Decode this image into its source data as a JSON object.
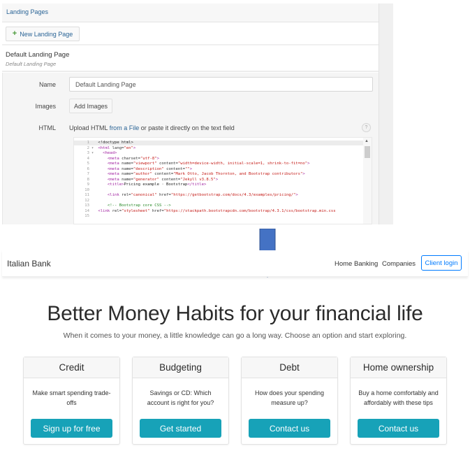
{
  "admin": {
    "section_title": "Landing Pages",
    "new_button_label": "New Landing Page",
    "new_button_icon": "plus-icon",
    "item": {
      "title": "Default Landing Page",
      "subtitle": "Default Landing Page"
    },
    "form": {
      "name_label": "Name",
      "name_value": "Default Landing Page",
      "images_label": "Images",
      "images_button": "Add Images",
      "html_label": "HTML",
      "upload_prefix": "Upload HTML ",
      "upload_link": "from a File",
      "upload_suffix": " or paste it directly on the text field",
      "help_icon": "?"
    },
    "code_lines": [
      {
        "n": "1",
        "fold": "",
        "parts": [
          [
            "tx",
            "<!doctype html>"
          ]
        ]
      },
      {
        "n": "2",
        "fold": "▾",
        "parts": [
          [
            "tg",
            "<html "
          ],
          [
            "at",
            "lang="
          ],
          [
            "st",
            "\"en\""
          ],
          [
            "tg",
            ">"
          ]
        ]
      },
      {
        "n": "3",
        "fold": "▾",
        "parts": [
          [
            "tx",
            "  "
          ],
          [
            "tg",
            "<head>"
          ]
        ]
      },
      {
        "n": "4",
        "fold": "",
        "parts": [
          [
            "tx",
            "    "
          ],
          [
            "tg",
            "<meta "
          ],
          [
            "at",
            "charset="
          ],
          [
            "st",
            "\"utf-8\""
          ],
          [
            "tg",
            ">"
          ]
        ]
      },
      {
        "n": "5",
        "fold": "",
        "parts": [
          [
            "tx",
            "    "
          ],
          [
            "tg",
            "<meta "
          ],
          [
            "at",
            "name="
          ],
          [
            "st",
            "\"viewport\""
          ],
          [
            "at",
            " content="
          ],
          [
            "st",
            "\"width=device-width, initial-scale=1, shrink-to-fit=no\""
          ],
          [
            "tg",
            ">"
          ]
        ]
      },
      {
        "n": "6",
        "fold": "",
        "parts": [
          [
            "tx",
            "    "
          ],
          [
            "tg",
            "<meta "
          ],
          [
            "at",
            "name="
          ],
          [
            "st",
            "\"description\""
          ],
          [
            "at",
            " content="
          ],
          [
            "st",
            "\"\""
          ],
          [
            "tg",
            ">"
          ]
        ]
      },
      {
        "n": "7",
        "fold": "",
        "parts": [
          [
            "tx",
            "    "
          ],
          [
            "tg",
            "<meta "
          ],
          [
            "at",
            "name="
          ],
          [
            "st",
            "\"author\""
          ],
          [
            "at",
            " content="
          ],
          [
            "st",
            "\"Mark Otto, Jacob Thornton, and Bootstrap contributors\""
          ],
          [
            "tg",
            ">"
          ]
        ]
      },
      {
        "n": "8",
        "fold": "",
        "parts": [
          [
            "tx",
            "    "
          ],
          [
            "tg",
            "<meta "
          ],
          [
            "at",
            "name="
          ],
          [
            "st",
            "\"generator\""
          ],
          [
            "at",
            " content="
          ],
          [
            "st",
            "\"Jekyll v3.8.5\""
          ],
          [
            "tg",
            ">"
          ]
        ]
      },
      {
        "n": "9",
        "fold": "",
        "parts": [
          [
            "tx",
            "    "
          ],
          [
            "tg",
            "<title>"
          ],
          [
            "tx",
            "Pricing example · Bootstrap"
          ],
          [
            "tg",
            "</title>"
          ]
        ]
      },
      {
        "n": "10",
        "fold": "",
        "parts": []
      },
      {
        "n": "11",
        "fold": "",
        "parts": [
          [
            "tx",
            "    "
          ],
          [
            "tg",
            "<link "
          ],
          [
            "at",
            "rel="
          ],
          [
            "st",
            "\"canonical\""
          ],
          [
            "at",
            " href="
          ],
          [
            "st",
            "\"https://getbootstrap.com/docs/4.3/examples/pricing/\""
          ],
          [
            "tg",
            ">"
          ]
        ]
      },
      {
        "n": "12",
        "fold": "",
        "parts": []
      },
      {
        "n": "13",
        "fold": "",
        "parts": [
          [
            "tx",
            "    "
          ],
          [
            "cm",
            "<!-- Bootstrap core CSS -->"
          ]
        ]
      },
      {
        "n": "14",
        "fold": "",
        "parts": [
          [
            "tg",
            "<link "
          ],
          [
            "at",
            "rel="
          ],
          [
            "st",
            "\"stylesheet\""
          ],
          [
            "at",
            " href="
          ],
          [
            "st",
            "\"https://stackpath.bootstrapcdn.com/bootstrap/4.3.1/css/bootstrap.min.css"
          ]
        ]
      },
      {
        "n": "15",
        "fold": "",
        "parts": []
      }
    ]
  },
  "arrow": {
    "color": "#4472c4",
    "icon": "down-arrow-icon"
  },
  "bank": {
    "brand": "Italian Bank",
    "nav_links": [
      "Home Banking",
      "Companies"
    ],
    "login_button": "Client login",
    "hero_title": "Better Money Habits for your financial life",
    "hero_subtitle": "When it comes to your money, a little knowledge can go a long way. Choose an option and start exploring.",
    "cards": [
      {
        "title": "Credit",
        "text": "Make smart spending trade-offs",
        "button": "Sign up for free"
      },
      {
        "title": "Budgeting",
        "text": "Savings or CD: Which account is right for you?",
        "button": "Get started"
      },
      {
        "title": "Debt",
        "text": "How does your spending measure up?",
        "button": "Contact us"
      },
      {
        "title": "Home ownership",
        "text": "Buy a home comfortably and affordably with these tips",
        "button": "Contact us"
      }
    ],
    "colors": {
      "primary": "#007bff",
      "info": "#17a2b8"
    }
  }
}
